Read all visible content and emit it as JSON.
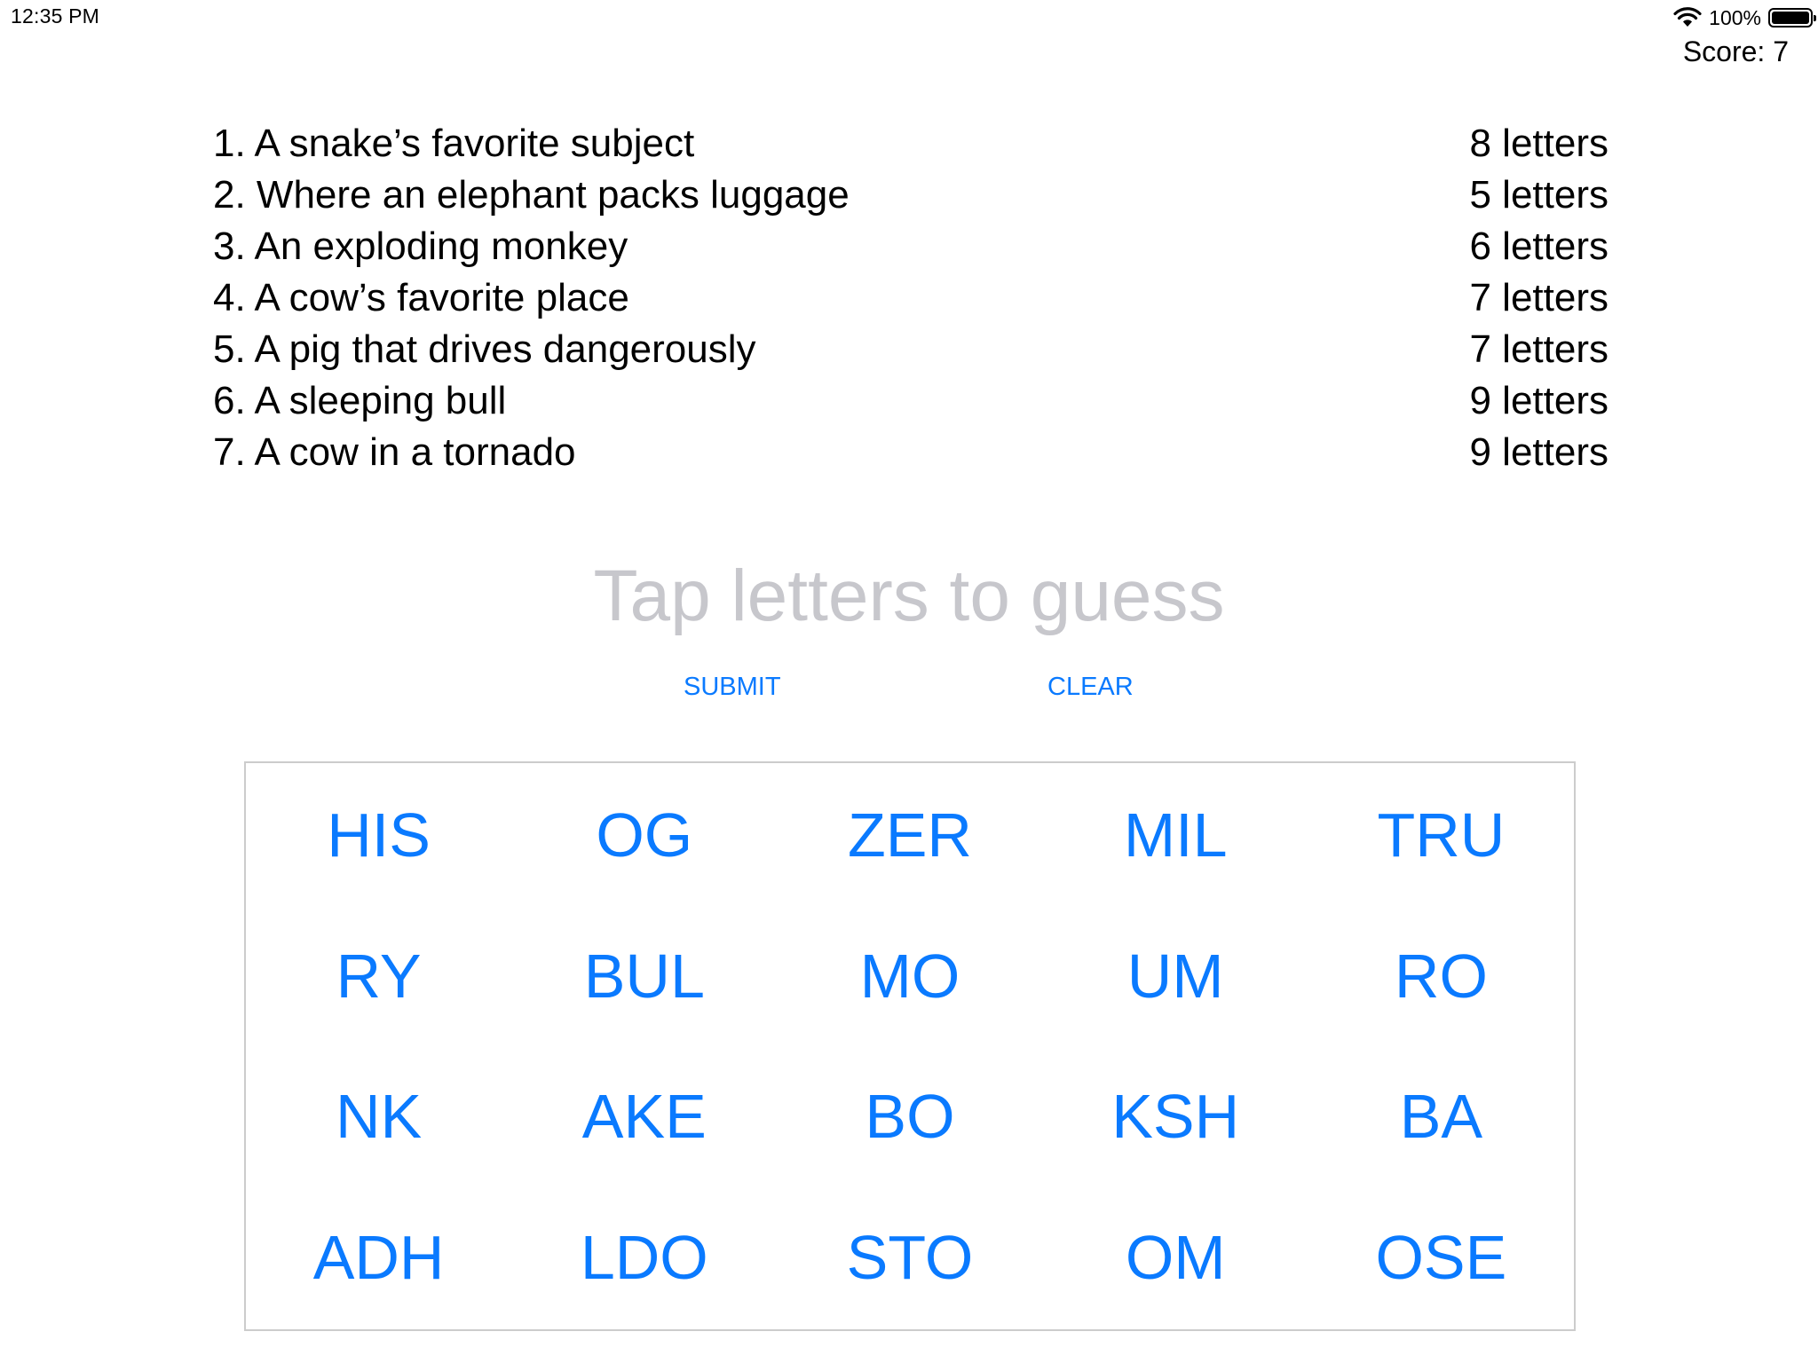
{
  "status_bar": {
    "time": "12:35 PM",
    "battery_percent": "100%",
    "icons": [
      "wifi-icon",
      "battery-icon"
    ]
  },
  "score_label": "Score: 7",
  "clues": [
    {
      "text": "1. A snake’s favorite subject",
      "length": "8 letters"
    },
    {
      "text": "2. Where an elephant packs luggage",
      "length": "5 letters"
    },
    {
      "text": "3. An exploding monkey",
      "length": "6 letters"
    },
    {
      "text": "4. A cow’s favorite place",
      "length": "7 letters"
    },
    {
      "text": "5. A pig that drives dangerously",
      "length": "7 letters"
    },
    {
      "text": "6. A sleeping bull",
      "length": "9 letters"
    },
    {
      "text": "7. A cow in a tornado",
      "length": "9 letters"
    }
  ],
  "guess_placeholder": "Tap letters to guess",
  "buttons": {
    "submit": "SUBMIT",
    "clear": "CLEAR"
  },
  "tiles": [
    "HIS",
    "OG",
    "ZER",
    "MIL",
    "TRU",
    "RY",
    "BUL",
    "MO",
    "UM",
    "RO",
    "NK",
    "AKE",
    "BO",
    "KSH",
    "BA",
    "ADH",
    "LDO",
    "STO",
    "OM",
    "OSE"
  ],
  "colors": {
    "accent": "#0a7aff",
    "placeholder": "#c7c7cc",
    "grid_border": "#cccccc"
  }
}
